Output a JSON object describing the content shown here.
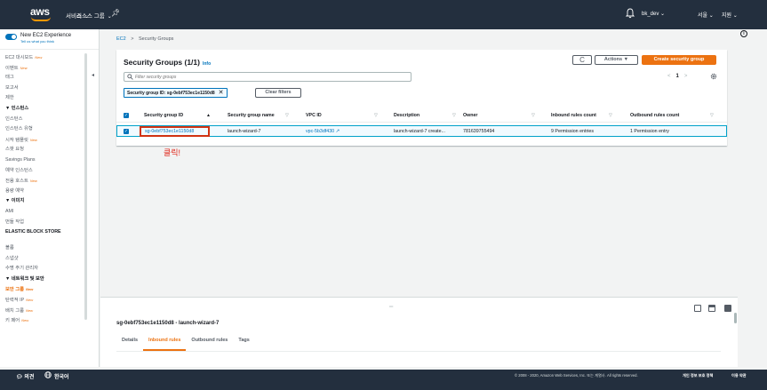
{
  "topnav": {
    "logo": "aws",
    "services": "서비스",
    "resource_groups": "리소스 그룹",
    "user": "bk_dev",
    "region": "서울",
    "support": "지원"
  },
  "sidebar": {
    "experience_title": "New EC2 Experience",
    "experience_sub": "Tell us what you think",
    "new_badge": "New",
    "items": [
      {
        "label": "EC2 대시보드",
        "new": true
      },
      {
        "label": "이벤트",
        "new": true
      },
      {
        "label": "태그"
      },
      {
        "label": "보고서"
      },
      {
        "label": "제한"
      },
      {
        "label": "▼ 인스턴스",
        "section": true
      },
      {
        "label": "인스턴스"
      },
      {
        "label": "인스턴스 유형"
      },
      {
        "label": "시작 템플릿",
        "new": true
      },
      {
        "label": "스팟 요청"
      },
      {
        "label": "Savings Plans"
      },
      {
        "label": "예약 인스턴스"
      },
      {
        "label": "전용 호스트",
        "new": true
      },
      {
        "label": "용량 예약"
      },
      {
        "label": "▼ 이미지",
        "section": true
      },
      {
        "label": "AMI"
      },
      {
        "label": "번들 작업"
      },
      {
        "label": "ELASTIC BLOCK STORE",
        "section": true,
        "two_line": true
      },
      {
        "label": "볼륨"
      },
      {
        "label": "스냅샷"
      },
      {
        "label": "수명 주기 관리자"
      },
      {
        "label": "▼ 네트워크 및 보안",
        "section": true
      },
      {
        "label": "보안 그룹",
        "new": true,
        "active": true
      },
      {
        "label": "탄력적 IP",
        "new": true
      },
      {
        "label": "배치 그룹",
        "new": true
      },
      {
        "label": "키 페어",
        "new": true
      }
    ]
  },
  "breadcrumb": {
    "root": "EC2",
    "sep": ">",
    "current": "Security Groups"
  },
  "panel": {
    "title": "Security Groups (1/1)",
    "info": "Info",
    "refresh": "C",
    "actions": "Actions ▼",
    "create": "Create security group",
    "search_placeholder": "Filter security groups",
    "page": "1",
    "prev": "<",
    "next": ">",
    "filter_chip": "Security group ID: sg-0ebf753ec1e1150d8",
    "filter_chip_close": "✕",
    "clear_filters": "Clear filters"
  },
  "table": {
    "columns": [
      "Security group ID",
      "Security group name",
      "VPC ID",
      "Description",
      "Owner",
      "Inbound rules count",
      "Outbound rules count"
    ],
    "header_check": "✓",
    "sort_asc": "▲",
    "sort_desc": "▽",
    "rows": [
      {
        "check": "✓",
        "id": "sg-0ebf753ec1e1150d8",
        "name": "launch-wizard-7",
        "vpc": "vpc-5b3df430",
        "vpc_ext": "↗",
        "description": "launch-wizard-7 create...",
        "owner": "781639755494",
        "inbound": "9 Permission entries",
        "outbound": "1 Permission entry"
      }
    ]
  },
  "annotation": "클릭!",
  "split": {
    "handle": "═",
    "title": "sg-0ebf753ec1e1150d8 - launch-wizard-7",
    "tabs": [
      "Details",
      "Inbound rules",
      "Outbound rules",
      "Tags"
    ],
    "active_tab": "Inbound rules"
  },
  "footer": {
    "feedback": "의견",
    "language": "한국어",
    "copyright": "© 2008 - 2020, Amazon Web Services, Inc. 또는 계열사. All rights reserved.",
    "privacy": "개인 정보 보호 정책",
    "terms": "이용 약관"
  },
  "colors": {
    "nav": "#232f3e",
    "accent": "#ec7211",
    "link": "#0073bb",
    "annotation": "#d13212"
  }
}
